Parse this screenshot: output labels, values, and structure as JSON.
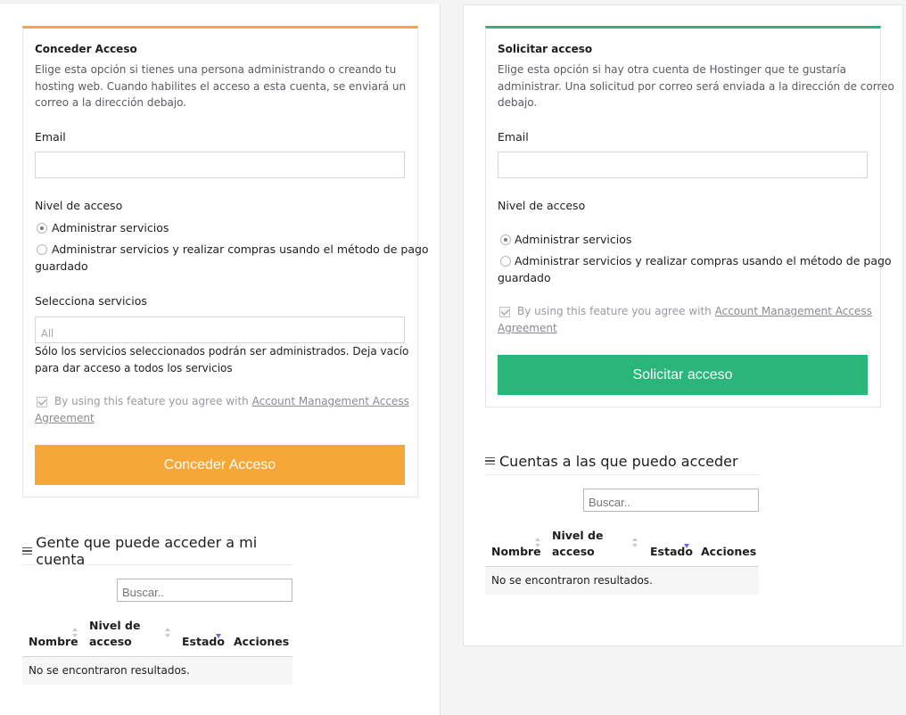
{
  "grant": {
    "title": "Conceder Acceso",
    "desc_lines": [
      "Elige esta opción si tienes una persona administrando o creando tu",
      "hosting web. Cuando habilites el acceso a esta cuenta, se enviará un",
      "correo a la dirección debajo."
    ],
    "email_label": "Email",
    "email_value": "",
    "access_label": "Nivel de acceso",
    "option1": "Administrar servicios",
    "option2_line1": "Administrar servicios y realizar compras usando el método de pago",
    "option2_line2": "guardado",
    "services_label": "Selecciona servicios",
    "services_value": "All",
    "services_help_lines": [
      "Sólo los servicios seleccionados podrán ser administrados. Deja vacío",
      "para dar acceso a todos los servicios"
    ],
    "agree_prefix": "By using this feature you agree with",
    "agree_link_1": "Account Management Access",
    "agree_link_2": "Agreement",
    "button": "Conceder Acceso",
    "accent": "#f5a738"
  },
  "request": {
    "title": "Solicitar acceso",
    "desc_lines": [
      "Elige esta opción si hay otra cuenta de Hostinger que te gustaría",
      "administrar. Una solicitud por correo será enviada a la dirección de correo",
      "debajo."
    ],
    "email_label": "Email",
    "email_value": "",
    "access_label": "Nivel de acceso",
    "option1": "Administrar servicios",
    "option2_line1": "Administrar servicios y realizar compras usando el método de pago",
    "option2_line2": "guardado",
    "agree_prefix": "By using this feature you agree with",
    "agree_link_1": "Account Management Access",
    "agree_link_2": "Agreement",
    "button": "Solicitar acceso",
    "accent": "#2ab67a"
  },
  "people_table": {
    "heading": "Gente que puede acceder a mi cuenta",
    "search_placeholder": "Buscar..",
    "col_nombre": "Nombre",
    "col_nivel_1": "Nivel de",
    "col_nivel_2": "acceso",
    "col_estado": "Estado",
    "col_acciones": "Acciones",
    "empty": "No se encontraron resultados."
  },
  "accounts_table": {
    "heading": "Cuentas a las que puedo acceder",
    "search_placeholder": "Buscar..",
    "col_nombre": "Nombre",
    "col_nivel_1": "Nivel de",
    "col_nivel_2": "acceso",
    "col_estado": "Estado",
    "col_acciones": "Acciones",
    "empty": "No se encontraron resultados."
  }
}
